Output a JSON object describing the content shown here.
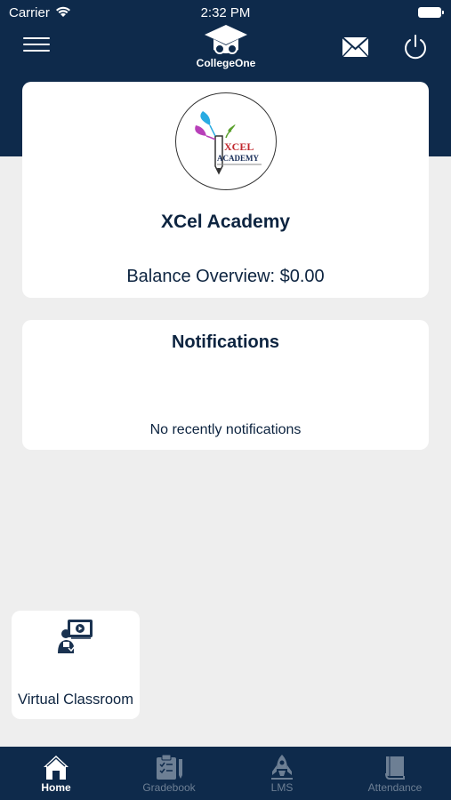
{
  "status_bar": {
    "carrier": "Carrier",
    "time": "2:32 PM"
  },
  "header": {
    "app_name": "CollegeOne"
  },
  "school": {
    "logo_text_line1": "XCEL",
    "logo_text_line2": "ACADEMY",
    "name": "XCel Academy",
    "balance": "Balance Overview: $0.00"
  },
  "notifications": {
    "title": "Notifications",
    "empty_message": "No recently notifications"
  },
  "modules": [
    {
      "label": "Virtual Classroom",
      "icon": "virtual-classroom-icon"
    }
  ],
  "tabs": [
    {
      "label": "Home",
      "icon": "home-icon",
      "active": true
    },
    {
      "label": "Gradebook",
      "icon": "clipboard-icon",
      "active": false
    },
    {
      "label": "LMS",
      "icon": "rocket-icon",
      "active": false
    },
    {
      "label": "Attendance",
      "icon": "book-icon",
      "active": false
    }
  ],
  "colors": {
    "header": "#0e2a4b",
    "background": "#eeeeee",
    "card": "#ffffff",
    "text": "#0d2440",
    "tab_inactive": "#6d7f94"
  }
}
